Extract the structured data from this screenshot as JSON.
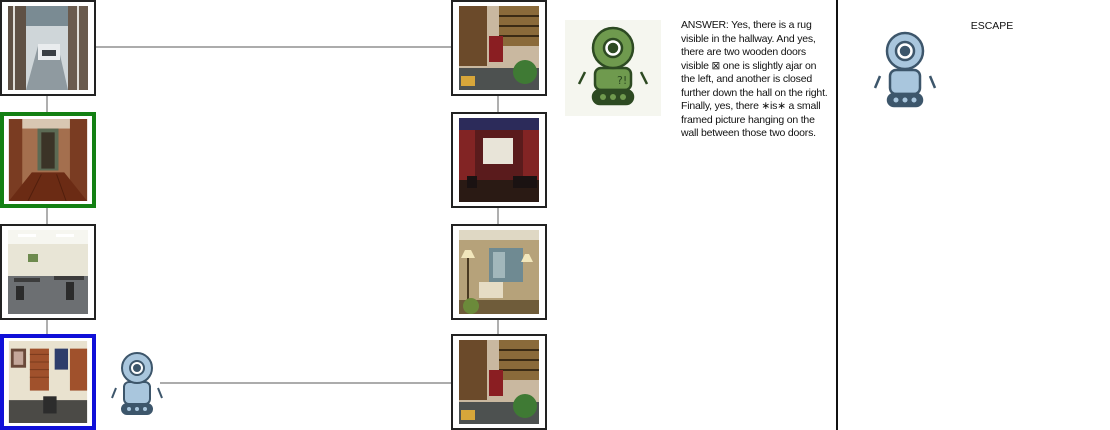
{
  "graph": {
    "left_column": [
      {
        "name": "hallway-with-car"
      },
      {
        "name": "wood-floor-hallway",
        "selected": "green"
      },
      {
        "name": "meeting-room"
      },
      {
        "name": "office-with-shutters",
        "selected": "blue"
      }
    ],
    "right_column": [
      {
        "name": "library-with-shelves"
      },
      {
        "name": "home-theater"
      },
      {
        "name": "living-room-with-lamps"
      },
      {
        "name": "library-with-shelves"
      }
    ]
  },
  "agent": {
    "current_icon": "blue-robot-icon",
    "answer_icon": "green-robot-icon",
    "answer_text": "ANSWER: Yes, there is a rug visible in the hallway. And yes, there are two wooden doors visible ⊠ one is slightly ajar on the left, and another is closed further down the hall on the right.\nFinally, yes, there ∗is∗ a small framed picture hanging on the wall between those two doors."
  },
  "escape": {
    "label": "ESCAPE",
    "icon": "blue-robot-icon"
  },
  "colors": {
    "selected_green": "#138013",
    "selected_blue": "#1010d8",
    "edge": "#7a7a7a",
    "robot_blue": "#a9c6dd",
    "robot_green": "#6f9a4e"
  }
}
